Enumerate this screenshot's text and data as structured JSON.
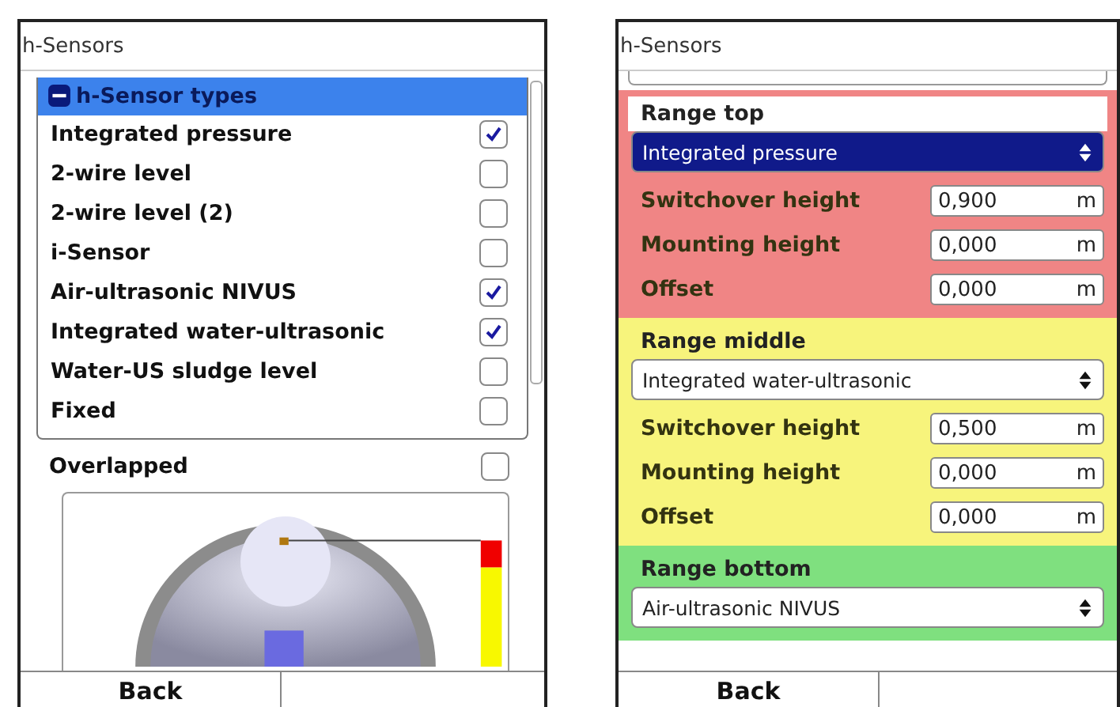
{
  "left_screen": {
    "title": "h-Sensors",
    "tree": {
      "header": "h-Sensor types",
      "expanded": true,
      "selected": true,
      "items": [
        {
          "label": "Integrated pressure",
          "checked": true
        },
        {
          "label": "2-wire level",
          "checked": false
        },
        {
          "label": "2-wire level (2)",
          "checked": false
        },
        {
          "label": "i-Sensor",
          "checked": false
        },
        {
          "label": "Air-ultrasonic NIVUS",
          "checked": true
        },
        {
          "label": "Integrated water-ultrasonic",
          "checked": true
        },
        {
          "label": "Water-US sludge level",
          "checked": false
        },
        {
          "label": "Fixed",
          "checked": false
        }
      ]
    },
    "overlapped": {
      "label": "Overlapped",
      "checked": false
    },
    "buttons": [
      "Back"
    ]
  },
  "right_screen": {
    "title": "h-Sensors",
    "sections": [
      {
        "title": "Range top",
        "color": "#f08585",
        "select": {
          "value": "Integrated pressure",
          "selected": true
        },
        "fields": [
          {
            "label": "Switchover height",
            "value": "0,900",
            "unit": "m"
          },
          {
            "label": "Mounting height",
            "value": "0,000",
            "unit": "m"
          },
          {
            "label": "Offset",
            "value": "0,000",
            "unit": "m"
          }
        ]
      },
      {
        "title": "Range middle",
        "color": "#f7f47c",
        "select": {
          "value": "Integrated water-ultrasonic",
          "selected": false
        },
        "fields": [
          {
            "label": "Switchover height",
            "value": "0,500",
            "unit": "m"
          },
          {
            "label": "Mounting height",
            "value": "0,000",
            "unit": "m"
          },
          {
            "label": "Offset",
            "value": "0,000",
            "unit": "m"
          }
        ]
      },
      {
        "title": "Range bottom",
        "color": "#7fe07f",
        "select": {
          "value": "Air-ultrasonic NIVUS",
          "selected": false
        }
      }
    ],
    "buttons": [
      "Back"
    ]
  }
}
